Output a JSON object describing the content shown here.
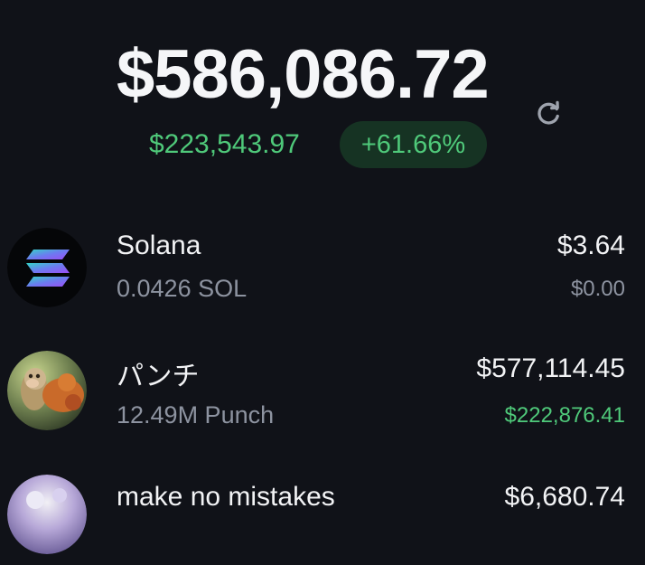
{
  "portfolio": {
    "balance": "$586,086.72",
    "change_amount": "$223,543.97",
    "change_percent": "+61.66%"
  },
  "icons": {
    "refresh": "refresh-icon"
  },
  "colors": {
    "background": "#101218",
    "positive": "#4fc97a",
    "positive_pill": "#163323",
    "muted": "#8d93a0",
    "text": "#f2f3f5"
  },
  "tokens": [
    {
      "name": "Solana",
      "amount": "0.0426 SOL",
      "value": "$3.64",
      "change": "$0.00",
      "change_status": "neutral",
      "logo": "solana-logo"
    },
    {
      "name": "パンチ",
      "amount": "12.49M Punch",
      "value": "$577,114.45",
      "change": "$222,876.41",
      "change_status": "positive",
      "logo": "punch-logo"
    },
    {
      "name": "make no mistakes",
      "value": "$6,680.74",
      "logo": "make-no-mistakes-logo"
    }
  ]
}
